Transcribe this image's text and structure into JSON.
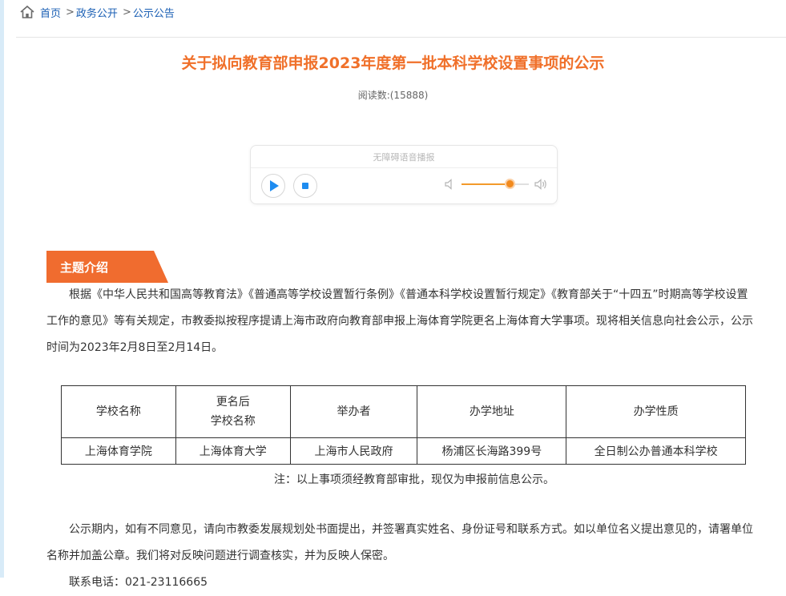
{
  "breadcrumb": {
    "home": "首页",
    "sep1": ">",
    "item1": "政务公开",
    "sep2": ">",
    "item2": "公示公告"
  },
  "article": {
    "title": "关于拟向教育部申报2023年度第一批本科学校设置事项的公示",
    "read_count": "阅读数:(15888)"
  },
  "player": {
    "title": "无障碍语音播报",
    "volume_level": 0.73,
    "accent_color": "#f28a1d",
    "icon_color": "#1e8cf0"
  },
  "section": {
    "label": "主题介绍",
    "color": "#f06c2f"
  },
  "content": {
    "p1": "根据《中华人民共和国高等教育法》《普通高等学校设置暂行条例》《普通本科学校设置暂行规定》《教育部关于“十四五”时期高等学校设置工作的意见》等有关规定，市教委拟按程序提请上海市政府向教育部申报上海体育学院更名上海体育大学事项。现将相关信息向社会公示，公示时间为2023年2月8日至2月14日。",
    "note": "注：以上事项须经教育部审批，现仅为申报前信息公示。",
    "p2": "公示期内，如有不同意见，请向市教委发展规划处书面提出，并签署真实姓名、身份证号和联系方式。如以单位名义提出意见的，请署单位名称并加盖公章。我们将对反映问题进行调查核实，并为反映人保密。",
    "p3": "联系电话：021-23116665"
  },
  "table": {
    "headers": {
      "c1": "学校名称",
      "c2_line1": "更名后",
      "c2_line2": "学校名称",
      "c3": "举办者",
      "c4": "办学地址",
      "c5": "办学性质"
    },
    "row": {
      "c1": "上海体育学院",
      "c2": "上海体育大学",
      "c3": "上海市人民政府",
      "c4": "杨浦区长海路399号",
      "c5": "全日制公办普通本科学校"
    }
  }
}
